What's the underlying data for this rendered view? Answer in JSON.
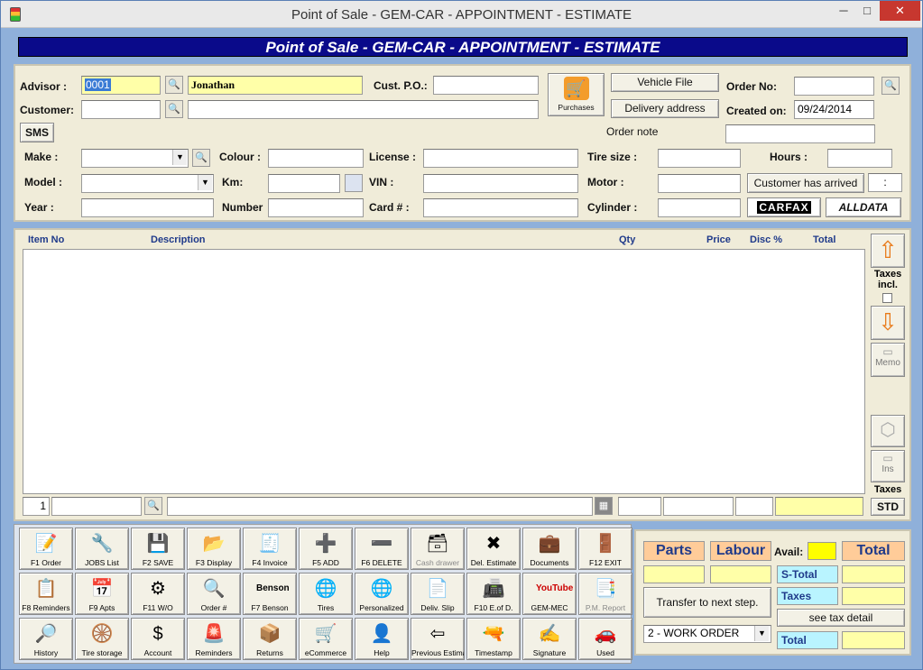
{
  "window": {
    "title": "Point of Sale - GEM-CAR  - APPOINTMENT - ESTIMATE",
    "minimize": "─",
    "maximize": "□",
    "close": "✕"
  },
  "banner": "Point of Sale - GEM-CAR  - APPOINTMENT - ESTIMATE",
  "header": {
    "advisor_label": "Advisor :",
    "advisor_code": "0001",
    "advisor_name": "Jonathan",
    "customer_label": "Customer:",
    "customer_value": "",
    "customer_name": "",
    "cust_po_label": "Cust. P.O.:",
    "cust_po_value": "",
    "purchases_label": "Purchases",
    "vehicle_file_label": "Vehicle File",
    "delivery_address_label": "Delivery address",
    "order_no_label": "Order No:",
    "order_no_value": "",
    "created_on_label": "Created on:",
    "created_on_value": "09/24/2014",
    "order_note_label": "Order note",
    "order_note_value": "",
    "sms_label": "SMS"
  },
  "vehicle": {
    "make_label": "Make :",
    "make_value": "",
    "model_label": "Model :",
    "model_value": "",
    "year_label": "Year :",
    "year_value": "",
    "colour_label": "Colour :",
    "colour_value": "",
    "km_label": "Km:",
    "km_value": "",
    "number_label": "Number",
    "number_value": "",
    "license_label": "License :",
    "license_value": "",
    "vin_label": "VIN :",
    "vin_value": "",
    "card_label": "Card # :",
    "card_value": "",
    "tire_size_label": "Tire size :",
    "tire_size_value": "",
    "motor_label": "Motor :",
    "motor_value": "",
    "cylinder_label": "Cylinder :",
    "cylinder_value": "",
    "hours_label": "Hours :",
    "hours_value": "",
    "customer_arrived_label": "Customer has arrived",
    "arrived_time": ":",
    "carfax_label": "CARFAX",
    "alldata_label": "ALLDATA"
  },
  "grid": {
    "columns": [
      "Item No",
      "Description",
      "Qty",
      "Price",
      "Disc %",
      "Total"
    ],
    "rows": [],
    "line_no": "1",
    "taxes_incl_label": "Taxes incl.",
    "memo_label": "Memo",
    "ins_label": "Ins",
    "taxes_label": "Taxes",
    "std_label": "STD"
  },
  "toolbar": {
    "row1": [
      {
        "label": "F1 Order",
        "icon": "📝",
        "enabled": true
      },
      {
        "label": "JOBS List",
        "icon": "🔧",
        "enabled": true
      },
      {
        "label": "F2 SAVE",
        "icon": "💾",
        "enabled": true
      },
      {
        "label": "F3 Display",
        "icon": "📂",
        "enabled": true
      },
      {
        "label": "F4 Invoice",
        "icon": "🧾",
        "enabled": true
      },
      {
        "label": "F5  ADD",
        "icon": "➕",
        "enabled": true
      },
      {
        "label": "F6  DELETE",
        "icon": "➖",
        "enabled": true
      },
      {
        "label": "Cash drawer",
        "icon": "🗃",
        "enabled": false
      },
      {
        "label": "Del. Estimate",
        "icon": "✖",
        "enabled": true
      },
      {
        "label": "Documents",
        "icon": "💼",
        "enabled": true
      },
      {
        "label": "F12 EXIT",
        "icon": "🚪",
        "enabled": true
      }
    ],
    "row2": [
      {
        "label": "F8 Reminders",
        "icon": "📋",
        "enabled": true
      },
      {
        "label": "F9 Apts",
        "icon": "📅",
        "enabled": true
      },
      {
        "label": "F11 W/O",
        "icon": "⚙",
        "enabled": true
      },
      {
        "label": "Order #",
        "icon": "🔍",
        "enabled": true
      },
      {
        "label": "F7 Benson",
        "icon": "Benson",
        "enabled": true
      },
      {
        "label": "Tires",
        "icon": "🌐",
        "enabled": true
      },
      {
        "label": "Personalized",
        "icon": "🌐",
        "enabled": true
      },
      {
        "label": "Deliv. Slip",
        "icon": "📄",
        "enabled": true
      },
      {
        "label": "F10 E.of D.",
        "icon": "📠",
        "enabled": true
      },
      {
        "label": "GEM-MEC",
        "icon": "YouTube",
        "enabled": true
      },
      {
        "label": "P.M. Report",
        "icon": "📑",
        "enabled": false
      }
    ],
    "row3": [
      {
        "label": "History",
        "icon": "🔎",
        "enabled": true
      },
      {
        "label": "Tire storage",
        "icon": "🛞",
        "enabled": true
      },
      {
        "label": "Account",
        "icon": "$",
        "enabled": true
      },
      {
        "label": "Reminders",
        "icon": "🚨",
        "enabled": true
      },
      {
        "label": "Returns",
        "icon": "📦",
        "enabled": true
      },
      {
        "label": "eCommerce",
        "icon": "🛒",
        "enabled": true
      },
      {
        "label": "Help",
        "icon": "👤",
        "enabled": true
      },
      {
        "label": "Previous Estimate",
        "icon": "⇦",
        "enabled": true
      },
      {
        "label": "Timestamp",
        "icon": "🔫",
        "enabled": true
      },
      {
        "label": "Signature",
        "icon": "✍",
        "enabled": true
      },
      {
        "label": "Used",
        "icon": "🚗",
        "enabled": true
      }
    ]
  },
  "totals": {
    "parts_label": "Parts",
    "labour_label": "Labour",
    "avail_label": "Avail:",
    "total_label": "Total",
    "transfer_label": "Transfer to next step.",
    "stotal_label": "S-Total",
    "taxes_label": "Taxes",
    "see_tax_label": "see tax detail",
    "work_order_value": "2 - WORK ORDER",
    "total_small_label": "Total"
  },
  "colors": {
    "banner": "#0a0a8a",
    "panel": "#f0ecd9",
    "yellow": "#ffffa8",
    "background": "#8fb0da"
  }
}
